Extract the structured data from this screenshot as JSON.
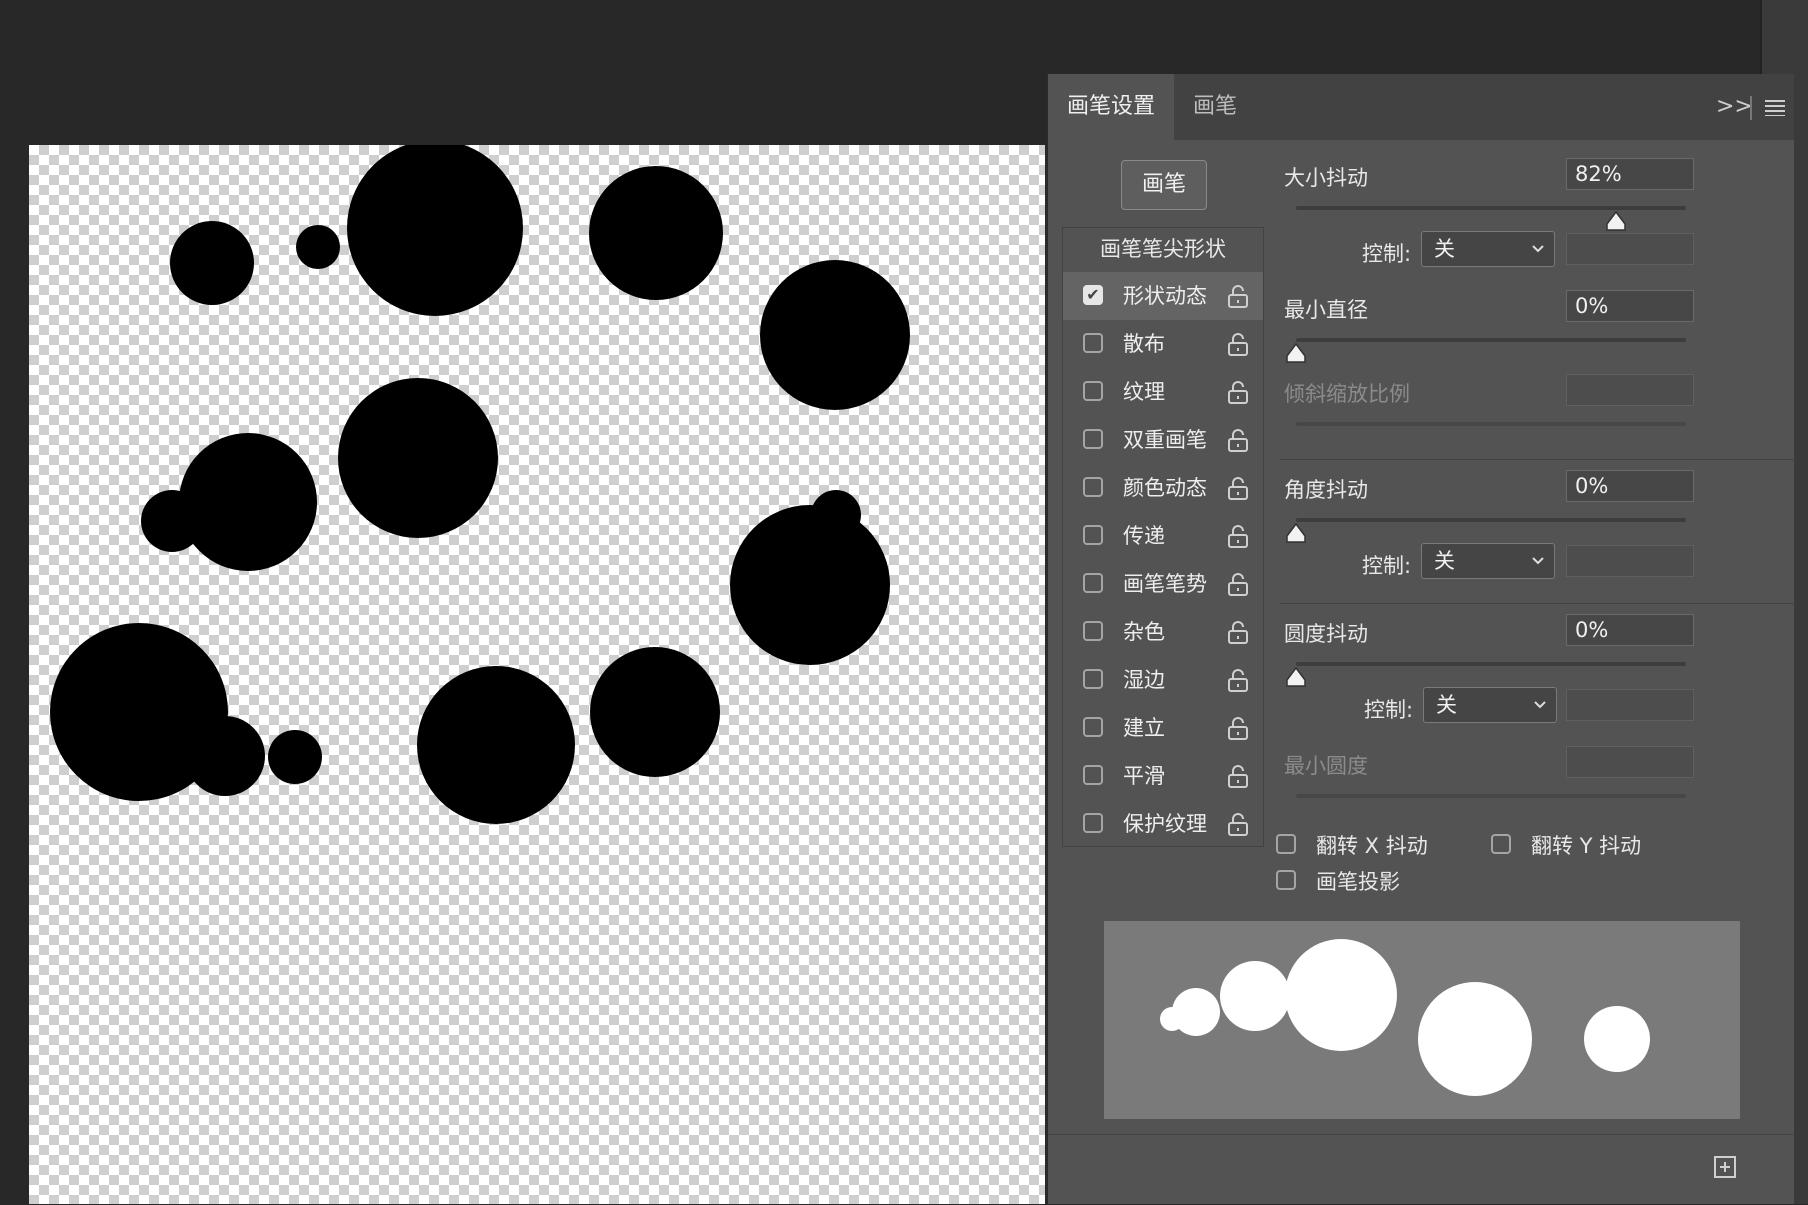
{
  "tabs": [
    "画笔设置",
    "画笔"
  ],
  "header_icons": {
    "expand": ">>",
    "menu": "menu-icon"
  },
  "brush_button": "画笔",
  "list_header": "画笔笔尖形状",
  "options": [
    {
      "label": "形状动态",
      "checked": true
    },
    {
      "label": "散布",
      "checked": false
    },
    {
      "label": "纹理",
      "checked": false
    },
    {
      "label": "双重画笔",
      "checked": false
    },
    {
      "label": "颜色动态",
      "checked": false
    },
    {
      "label": "传递",
      "checked": false
    },
    {
      "label": "画笔笔势",
      "checked": false
    },
    {
      "label": "杂色",
      "checked": false
    },
    {
      "label": "湿边",
      "checked": false
    },
    {
      "label": "建立",
      "checked": false
    },
    {
      "label": "平滑",
      "checked": false
    },
    {
      "label": "保护纹理",
      "checked": false
    }
  ],
  "size_jitter": {
    "label": "大小抖动",
    "value": "82%",
    "fraction": 0.82
  },
  "control_label": "控制:",
  "control_value": "关",
  "min_diameter": {
    "label": "最小直径",
    "value": "0%",
    "fraction": 0
  },
  "tilt_scale": {
    "label": "倾斜缩放比例"
  },
  "angle_jitter": {
    "label": "角度抖动",
    "value": "0%",
    "fraction": 0
  },
  "roundness_jitter": {
    "label": "圆度抖动",
    "value": "0%",
    "fraction": 0
  },
  "min_roundness": {
    "label": "最小圆度"
  },
  "flip_x": "翻转 X 抖动",
  "flip_y": "翻转 Y 抖动",
  "brush_projection": "画笔投影",
  "colors": {
    "panel": "#535353",
    "tab_bar": "#424242",
    "preview_bg": "#7a7a7a",
    "canvas_dot": "#000000"
  }
}
